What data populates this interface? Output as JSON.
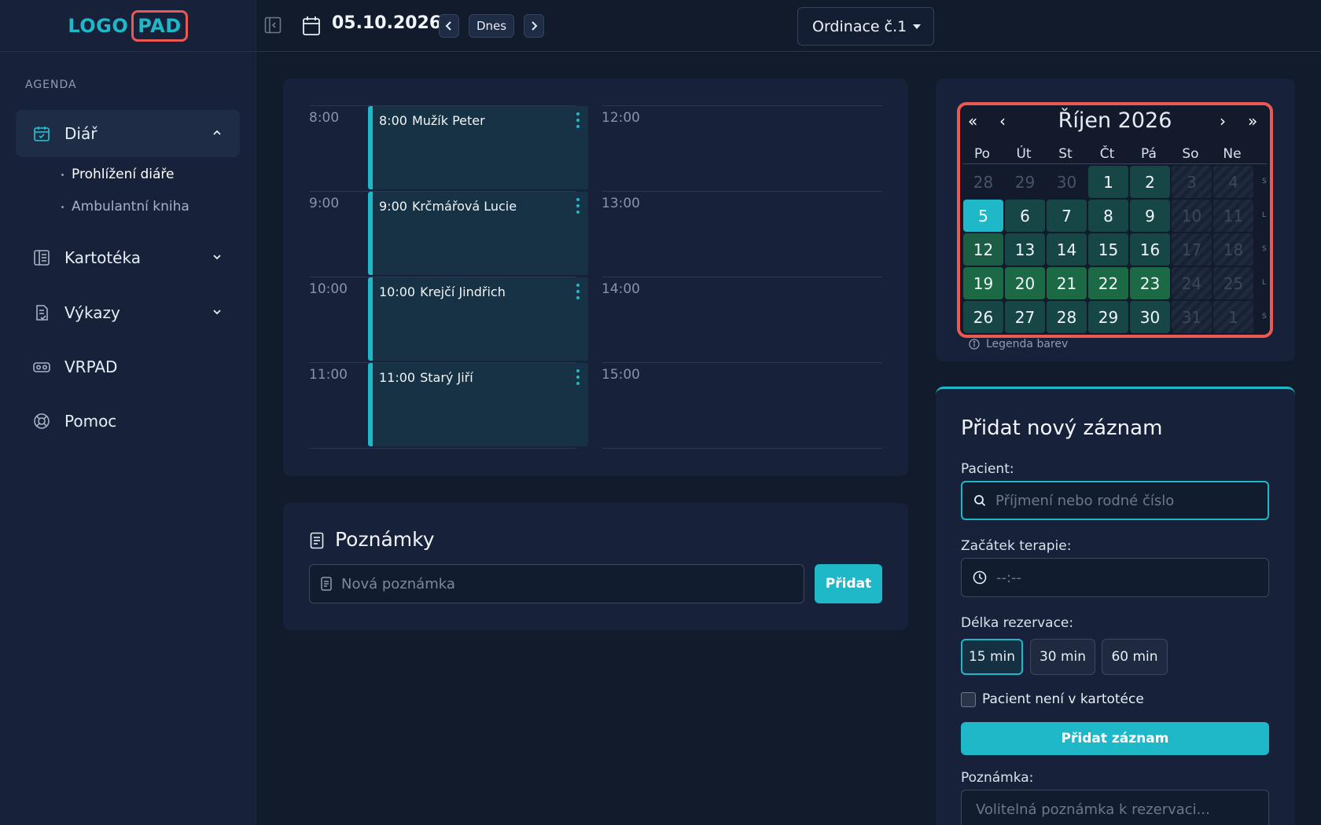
{
  "brand": {
    "logo_left": "LOGO",
    "logo_right": "PAD"
  },
  "sidebar": {
    "section": "AGENDA",
    "items": [
      {
        "label": "Diář",
        "icon": "calendar-check-icon"
      },
      {
        "label": "Kartotéka",
        "icon": "card-index-icon"
      },
      {
        "label": "Výkazy",
        "icon": "report-icon"
      },
      {
        "label": "VRPAD",
        "icon": "vr-headset-icon"
      },
      {
        "label": "Pomoc",
        "icon": "lifebuoy-icon"
      }
    ],
    "subitems": [
      "Prohlížení diáře",
      "Ambulantní kniha"
    ]
  },
  "topbar": {
    "date": "05.10.2026",
    "today_label": "Dnes",
    "clinic": "Ordinace č.1"
  },
  "schedule": {
    "left_times": [
      "8:00",
      "9:00",
      "10:00",
      "11:00"
    ],
    "right_times": [
      "12:00",
      "13:00",
      "14:00",
      "15:00"
    ],
    "appointments": [
      {
        "time": "8:00",
        "name": "Mužík Peter"
      },
      {
        "time": "9:00",
        "name": "Krčmářová Lucie"
      },
      {
        "time": "10:00",
        "name": "Krejčí Jindřich"
      },
      {
        "time": "11:00",
        "name": "Starý Jiří"
      }
    ]
  },
  "notes": {
    "title": "Poznámky",
    "placeholder": "Nová poznámka",
    "add_label": "Přidat"
  },
  "calendar": {
    "title": "Říjen 2026",
    "nav": {
      "prev_year": "«",
      "prev_month": "‹",
      "next_month": "›",
      "next_year": "»"
    },
    "weekdays": [
      "Po",
      "Út",
      "St",
      "Čt",
      "Pá",
      "So",
      "Ne"
    ],
    "weeks": [
      [
        "28",
        "29",
        "30",
        "1",
        "2",
        "3",
        "4"
      ],
      [
        "5",
        "6",
        "7",
        "8",
        "9",
        "10",
        "11"
      ],
      [
        "12",
        "13",
        "14",
        "15",
        "16",
        "17",
        "18"
      ],
      [
        "19",
        "20",
        "21",
        "22",
        "23",
        "24",
        "25"
      ],
      [
        "26",
        "27",
        "28",
        "29",
        "30",
        "31",
        "1"
      ]
    ],
    "week_markers": [
      "S",
      "L",
      "S",
      "L",
      "S"
    ],
    "selected_day": "5",
    "legend": "Legenda barev",
    "colors": {
      "today": "#1fb8c8",
      "available": "#1c6a45",
      "partial": "#164746",
      "weekend": "#1f2a3e"
    }
  },
  "add_record": {
    "title": "Přidat nový záznam",
    "patient_label": "Pacient:",
    "patient_placeholder": "Příjmení nebo rodné číslo",
    "start_label": "Začátek terapie:",
    "start_placeholder": "--:--",
    "duration_label": "Délka rezervace:",
    "durations": [
      "15 min",
      "30 min",
      "60 min"
    ],
    "selected_duration": "15 min",
    "not_in_index_label": "Pacient není v kartotéce",
    "submit_label": "Přidat záznam",
    "note_label": "Poznámka:",
    "note_placeholder": "Volitelná poznámka k rezervaci..."
  },
  "theme": {
    "accent": "#1fb8c8",
    "highlight_border": "#ea5a52",
    "background": "#111b2b",
    "panel": "#17223a"
  }
}
